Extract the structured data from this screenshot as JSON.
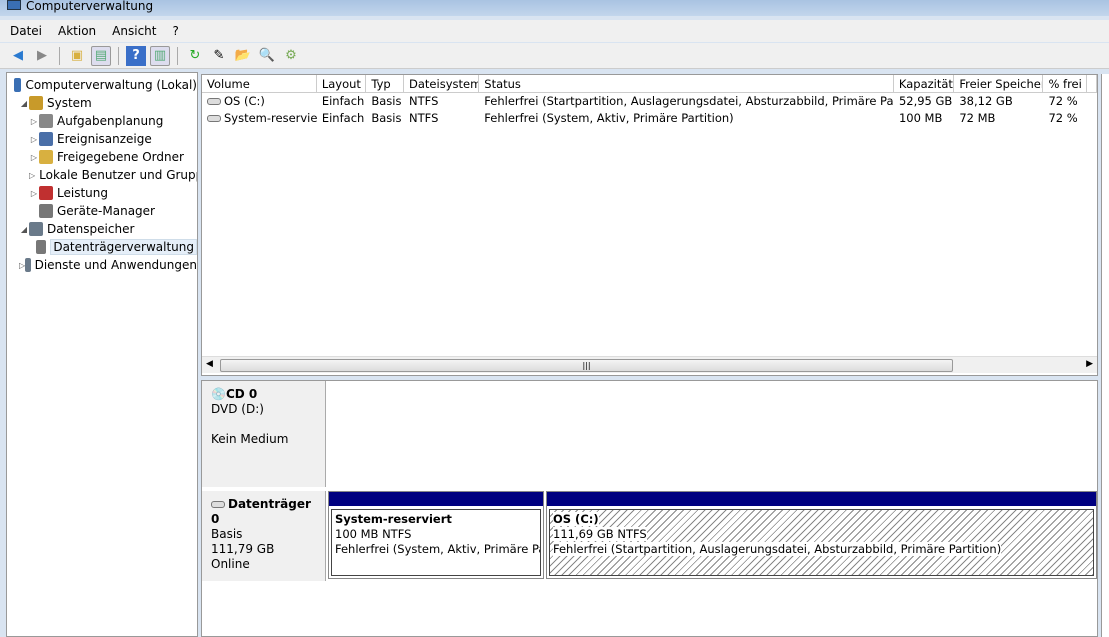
{
  "window": {
    "title": "Computerverwaltung"
  },
  "menu": [
    "Datei",
    "Aktion",
    "Ansicht",
    "?"
  ],
  "tree": [
    {
      "label": "Computerverwaltung (Lokal)",
      "level": 0,
      "arrow": "",
      "color": "#3a6fb4"
    },
    {
      "label": "System",
      "level": 1,
      "arrow": "◢",
      "color": "#c89a2a"
    },
    {
      "label": "Aufgabenplanung",
      "level": 2,
      "arrow": "▷",
      "color": "#888"
    },
    {
      "label": "Ereignisanzeige",
      "level": 2,
      "arrow": "▷",
      "color": "#4a6fa8"
    },
    {
      "label": "Freigegebene Ordner",
      "level": 2,
      "arrow": "▷",
      "color": "#d8b040"
    },
    {
      "label": "Lokale Benutzer und Gruppen",
      "level": 2,
      "arrow": "▷",
      "color": "#5a8a3a"
    },
    {
      "label": "Leistung",
      "level": 2,
      "arrow": "▷",
      "color": "#c03030"
    },
    {
      "label": "Geräte-Manager",
      "level": 2,
      "arrow": "",
      "color": "#777"
    },
    {
      "label": "Datenspeicher",
      "level": 1,
      "arrow": "◢",
      "color": "#6a7a8a"
    },
    {
      "label": "Datenträgerverwaltung",
      "level": 2,
      "arrow": "",
      "color": "#777",
      "selected": true
    },
    {
      "label": "Dienste und Anwendungen",
      "level": 1,
      "arrow": "▷",
      "color": "#6a7a8a"
    }
  ],
  "columns": [
    "Volume",
    "Layout",
    "Typ",
    "Dateisystem",
    "Status",
    "Kapazität",
    "Freier Speicher",
    "% frei",
    ""
  ],
  "rows": [
    [
      "OS (C:)",
      "Einfach",
      "Basis",
      "NTFS",
      "Fehlerfrei (Startpartition, Auslagerungsdatei, Absturzabbild, Primäre Partition)",
      "52,95 GB",
      "38,12 GB",
      "72 %",
      ""
    ],
    [
      "System-reserviert",
      "Einfach",
      "Basis",
      "NTFS",
      "Fehlerfrei (System, Aktiv, Primäre Partition)",
      "100 MB",
      "72 MB",
      "72 %",
      ""
    ]
  ],
  "scroll_grip": "|||",
  "cd": {
    "name": "CD 0",
    "drive": "DVD (D:)",
    "status": "Kein Medium"
  },
  "disk0": {
    "name": "Datenträger 0",
    "type": "Basis",
    "size": "111,79 GB",
    "state": "Online",
    "partitions": [
      {
        "name": "System-reserviert",
        "size": "100 MB NTFS",
        "status": "Fehlerfrei (System, Aktiv, Primäre Partition)"
      },
      {
        "name": "OS  (C:)",
        "size": "111,69 GB NTFS",
        "status": "Fehlerfrei (Startpartition, Auslagerungsdatei, Absturzabbild, Primäre Partition)"
      }
    ]
  }
}
